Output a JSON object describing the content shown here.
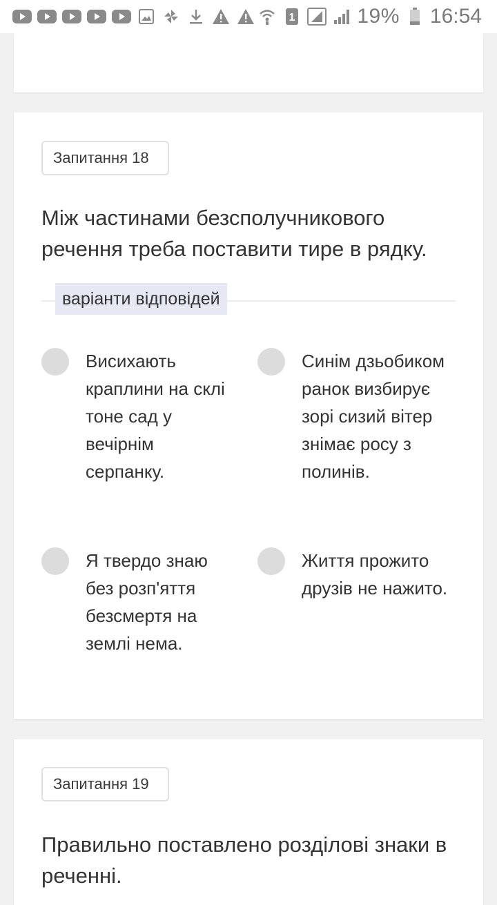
{
  "status_bar": {
    "notification_icons": [
      "youtube-icon",
      "youtube-icon",
      "youtube-icon",
      "youtube-icon",
      "youtube-icon",
      "image-icon",
      "pinwheel-icon",
      "download-icon",
      "warning-icon",
      "warning-icon"
    ],
    "sim_badge": "1",
    "battery_percent": "19%",
    "time": "16:54"
  },
  "questions": [
    {
      "badge": "Запитання 18",
      "text": "Між частинами безсполучникового речення треба поставити тире в рядку.",
      "answers_label": "варіанти відповідей",
      "options": [
        {
          "text": "Висихають краплини на склі тоне сад у вечірнім серпанку."
        },
        {
          "text": "Синім дзьобиком ранок визбирує зорі сизий вітер знімає росу з полинів."
        },
        {
          "text": "Я твердо знаю без розп'яття безсмертя на землі нема."
        },
        {
          "text": "Життя прожито друзів не нажито."
        }
      ]
    },
    {
      "badge": "Запитання 19",
      "text": "Правильно поставлено розділові знаки в реченні."
    }
  ],
  "colors": {
    "background": "#f1f1f1",
    "card": "#ffffff",
    "answers_label_bg": "#e6e8f4",
    "radio": "#dcdcdc"
  }
}
